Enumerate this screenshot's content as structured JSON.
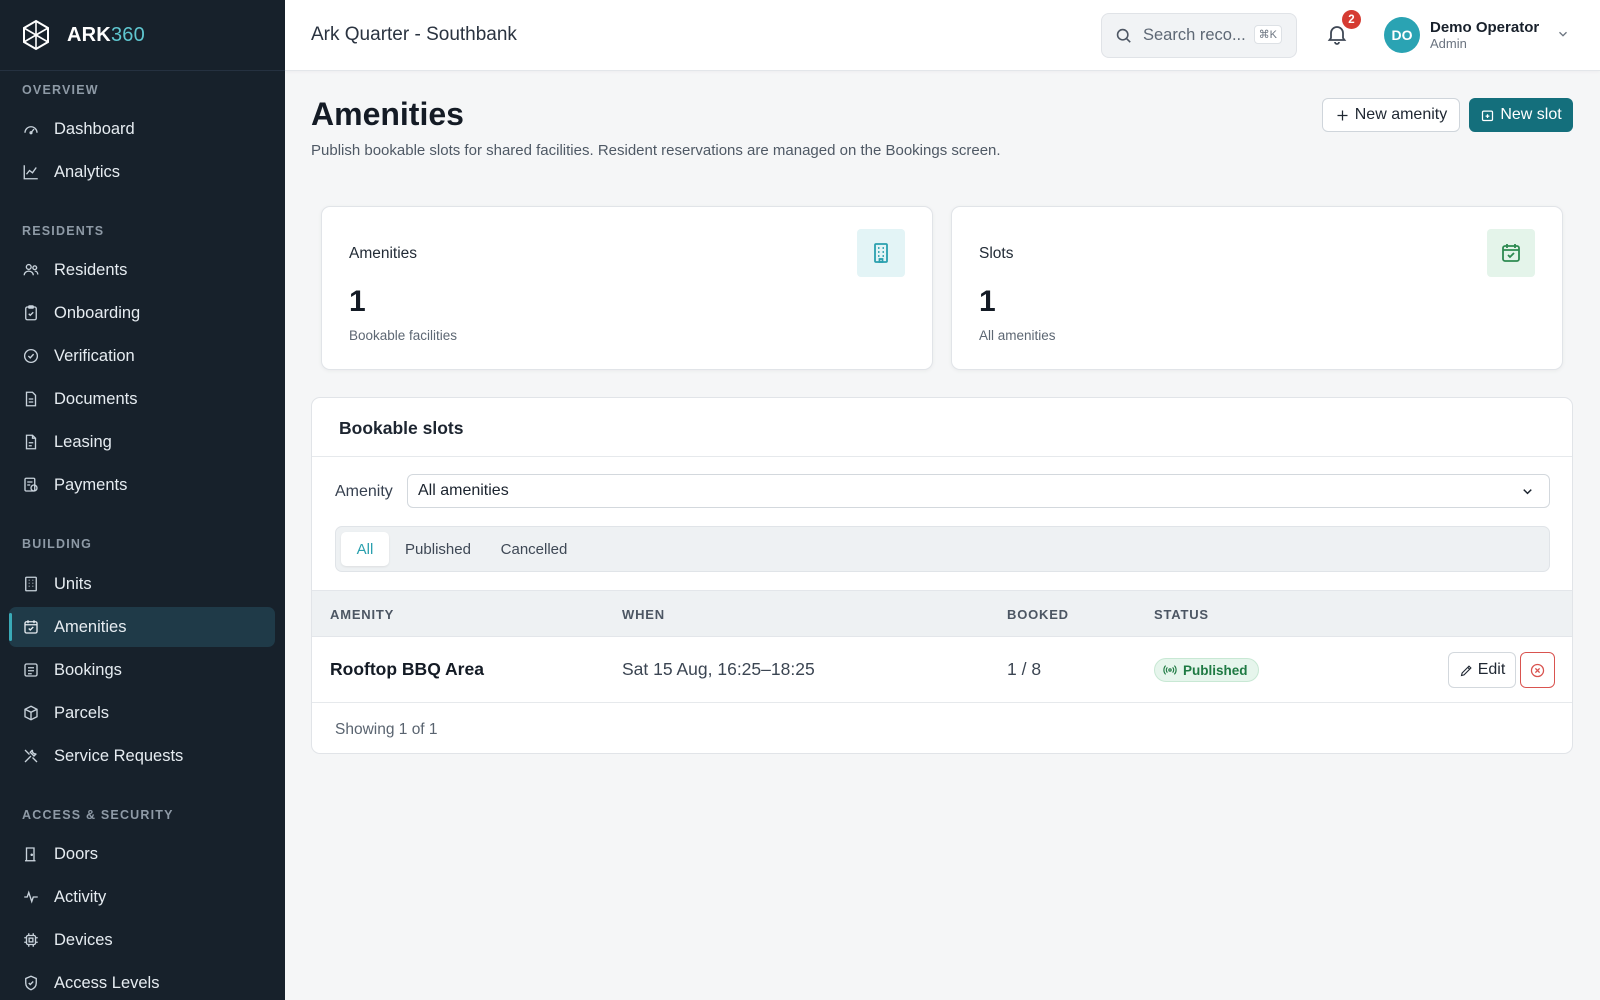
{
  "brand": {
    "name": "ARK",
    "number": "360"
  },
  "sidebar": {
    "sections": [
      {
        "title": "OVERVIEW",
        "items": [
          {
            "label": "Dashboard",
            "icon": "gauge-icon"
          },
          {
            "label": "Analytics",
            "icon": "line-chart-icon"
          }
        ]
      },
      {
        "title": "RESIDENTS",
        "items": [
          {
            "label": "Residents",
            "icon": "users-icon"
          },
          {
            "label": "Onboarding",
            "icon": "clipboard-icon"
          },
          {
            "label": "Verification",
            "icon": "check-circle-icon"
          },
          {
            "label": "Documents",
            "icon": "document-icon"
          },
          {
            "label": "Leasing",
            "icon": "file-text-icon"
          },
          {
            "label": "Payments",
            "icon": "receipt-icon"
          }
        ]
      },
      {
        "title": "BUILDING",
        "items": [
          {
            "label": "Units",
            "icon": "building-icon"
          },
          {
            "label": "Amenities",
            "icon": "calendar-check-icon",
            "active": true
          },
          {
            "label": "Bookings",
            "icon": "calendar-list-icon"
          },
          {
            "label": "Parcels",
            "icon": "package-icon"
          },
          {
            "label": "Service Requests",
            "icon": "wrench-icon"
          }
        ]
      },
      {
        "title": "ACCESS & SECURITY",
        "items": [
          {
            "label": "Doors",
            "icon": "door-icon"
          },
          {
            "label": "Activity",
            "icon": "activity-icon"
          },
          {
            "label": "Devices",
            "icon": "cpu-icon"
          },
          {
            "label": "Access Levels",
            "icon": "shield-icon"
          }
        ]
      }
    ]
  },
  "header": {
    "property": "Ark Quarter - Southbank",
    "search_placeholder": "Search reco...",
    "search_shortcut": "⌘K",
    "notifications_count": "2",
    "user": {
      "initials": "DO",
      "name": "Demo Operator",
      "role": "Admin"
    }
  },
  "page": {
    "title": "Amenities",
    "subtitle": "Publish bookable slots for shared facilities. Resident reservations are managed on the Bookings screen.",
    "actions": {
      "new_amenity": "New amenity",
      "new_slot": "New slot"
    }
  },
  "stats": [
    {
      "label": "Amenities",
      "value": "1",
      "caption": "Bookable facilities",
      "icon": "building-icon",
      "icon_color": "#2aa0ae",
      "icon_bg": "#e3f4f6"
    },
    {
      "label": "Slots",
      "value": "1",
      "caption": "All amenities",
      "icon": "calendar-check-icon",
      "icon_color": "#2e8a52",
      "icon_bg": "#e4f4ea"
    }
  ],
  "slots_panel": {
    "title": "Bookable slots",
    "filter_label": "Amenity",
    "filter_value": "All amenities",
    "tabs": [
      {
        "label": "All",
        "active": true
      },
      {
        "label": "Published"
      },
      {
        "label": "Cancelled"
      }
    ],
    "columns": [
      "AMENITY",
      "WHEN",
      "BOOKED",
      "STATUS"
    ],
    "rows": [
      {
        "amenity": "Rooftop BBQ Area",
        "when": "Sat 15 Aug, 16:25–18:25",
        "booked": "1 / 8",
        "status": "Published",
        "edit_label": "Edit"
      }
    ],
    "footer": "Showing 1 of 1"
  },
  "colors": {
    "sidebar_bg": "#17212b",
    "accent": "#146f7c",
    "accent_light": "#2aa0ae",
    "danger": "#d9534f",
    "success": "#1f7a43"
  }
}
